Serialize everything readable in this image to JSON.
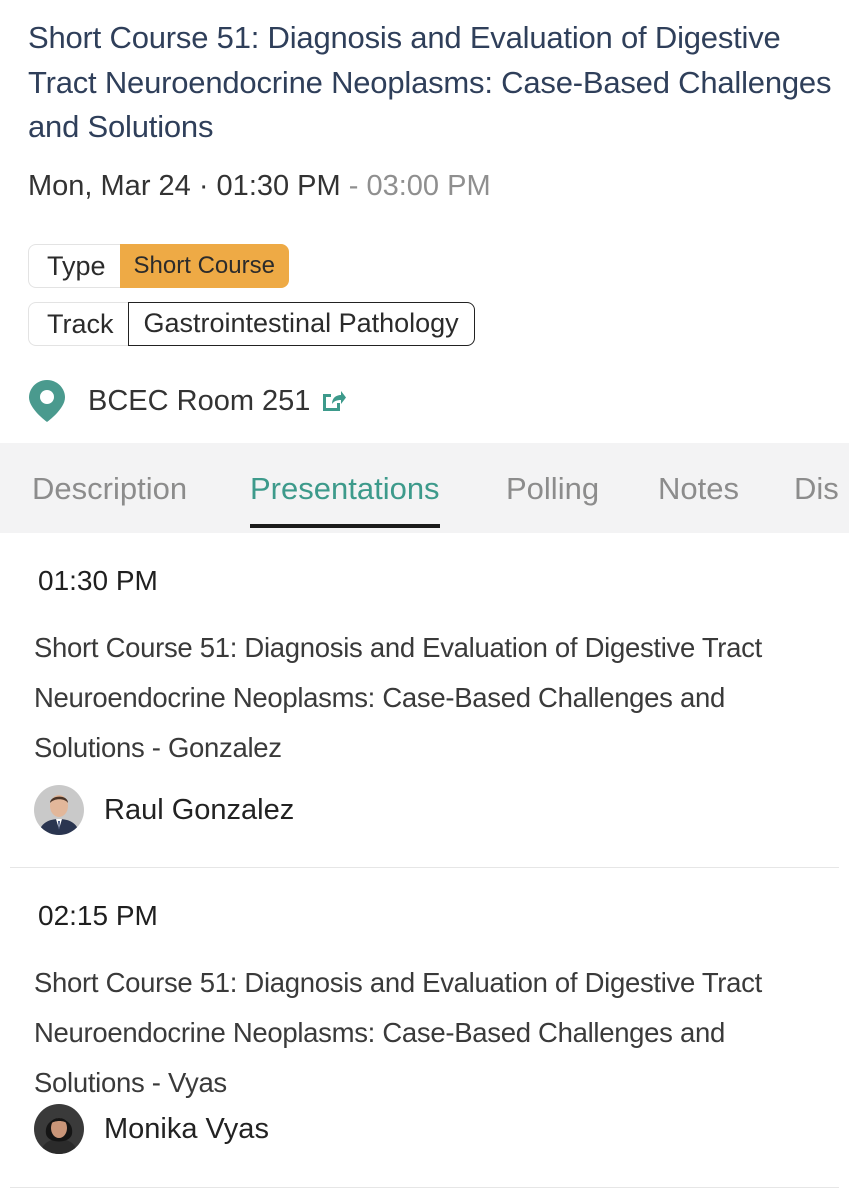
{
  "session": {
    "title": "Short Course 51: Diagnosis and Evaluation of Digestive Tract Neuroendocrine Neoplasms: Case-Based Challenges and Solutions",
    "time_start": "Mon, Mar 24 · 01:30 PM",
    "time_sep": " - ",
    "time_end": "03:00 PM",
    "type_label": "Type",
    "type_value": "Short Course",
    "track_label": "Track",
    "track_value": "Gastrointestinal Pathology",
    "location": "BCEC Room 251",
    "location_icon": "map-pin-icon",
    "external_icon": "external-link-icon"
  },
  "colors": {
    "title": "#2f3f5a",
    "accent": "#3d9a8b",
    "type_badge": "#eeaa45",
    "pin": "#4a9a8e"
  },
  "tabs": [
    {
      "label": "Description",
      "active": false
    },
    {
      "label": "Presentations",
      "active": true
    },
    {
      "label": "Polling",
      "active": false
    },
    {
      "label": "Notes",
      "active": false
    },
    {
      "label": "Dis",
      "active": false
    }
  ],
  "presentations": [
    {
      "time": "01:30 PM",
      "title": "Short Course 51: Diagnosis and Evaluation of Digestive Tract Neuroendocrine Neoplasms: Case-Based Challenges and Solutions - Gonzalez",
      "speaker": "Raul Gonzalez"
    },
    {
      "time": "02:15 PM",
      "title": "Short Course 51: Diagnosis and Evaluation of Digestive Tract Neuroendocrine Neoplasms: Case-Based Challenges and Solutions - Vyas",
      "speaker": "Monika Vyas"
    }
  ]
}
